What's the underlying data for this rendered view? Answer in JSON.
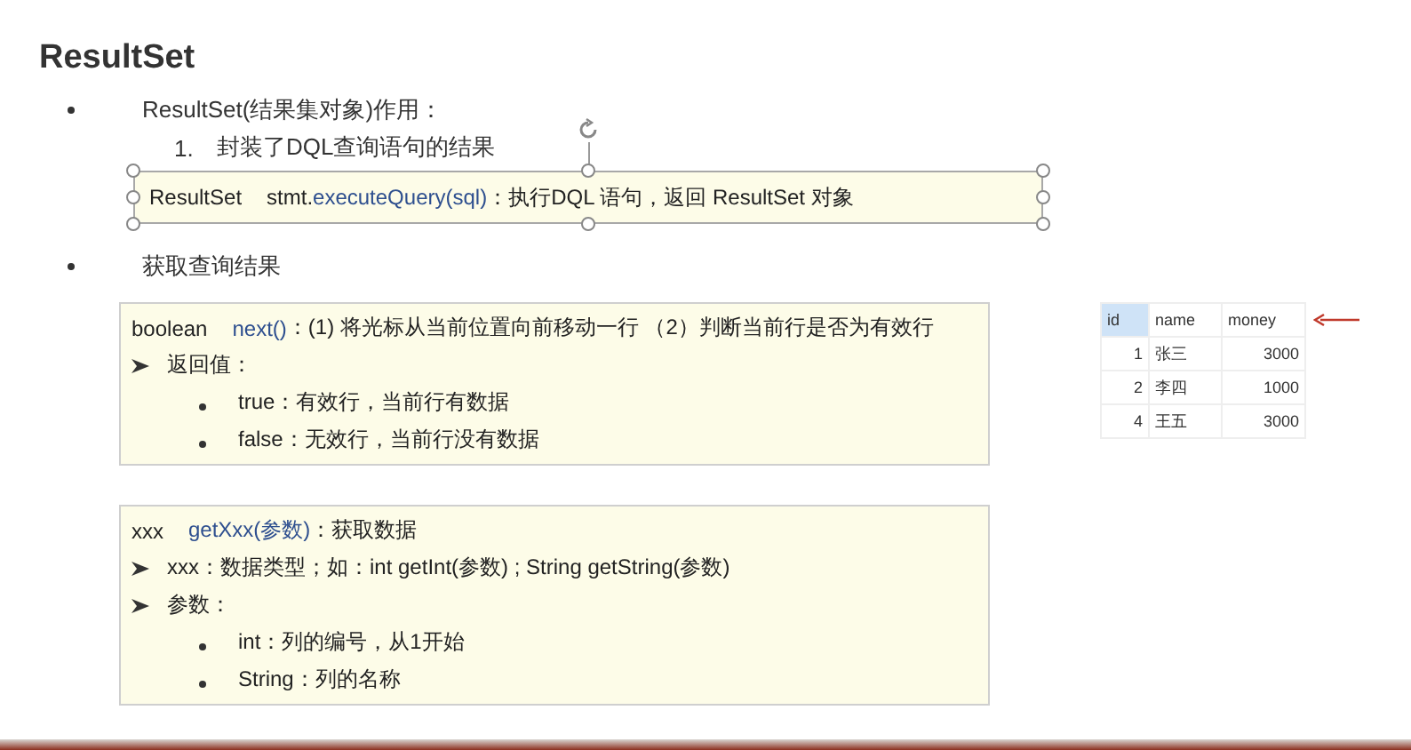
{
  "title": "ResultSet",
  "bullets": [
    {
      "text": "ResultSet(结果集对象)作用：",
      "items": [
        {
          "number": "1.",
          "text": "封装了DQL查询语句的结果"
        }
      ],
      "boxes": [
        {
          "selected": true,
          "lines": [
            {
              "kind": "signature",
              "type": "ResultSet",
              "prefix": "stmt.",
              "method": "executeQuery(sql)",
              "desc": "：执行DQL 语句，返回 ResultSet 对象"
            }
          ]
        }
      ]
    },
    {
      "text": "获取查询结果",
      "boxes": [
        {
          "selected": false,
          "lines": [
            {
              "kind": "signature",
              "type": "boolean",
              "method": "next()",
              "desc": "：(1) 将光标从当前位置向前移动一行  （2）判断当前行是否为有效行"
            },
            {
              "kind": "arrow",
              "text": "返回值："
            },
            {
              "kind": "dot",
              "text": "true：有效行，当前行有数据"
            },
            {
              "kind": "dot",
              "text": "false：无效行，当前行没有数据"
            }
          ]
        },
        {
          "selected": false,
          "lines": [
            {
              "kind": "signature",
              "type": "xxx",
              "method": "getXxx(参数)",
              "desc": "：获取数据"
            },
            {
              "kind": "arrow",
              "text": "xxx：数据类型；如：int getInt(参数) ; String getString(参数)"
            },
            {
              "kind": "arrow",
              "text": "参数："
            },
            {
              "kind": "dot",
              "text": "int：列的编号，从1开始"
            },
            {
              "kind": "dot",
              "text": "String：列的名称"
            }
          ]
        }
      ]
    }
  ],
  "table": {
    "columns": [
      "id",
      "name",
      "money"
    ],
    "rows": [
      [
        "1",
        "张三",
        "3000"
      ],
      [
        "2",
        "李四",
        "1000"
      ],
      [
        "4",
        "王五",
        "3000"
      ]
    ]
  }
}
